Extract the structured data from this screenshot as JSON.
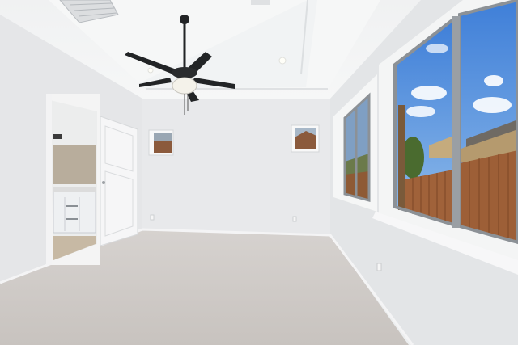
{
  "photo": {
    "subject": "empty-bedroom-interior",
    "colors": {
      "ceiling": "#f2f3f4",
      "tray_ceiling": "#f7f8f8",
      "wall_left": "#e7e8ea",
      "wall_back": "#e9eaec",
      "wall_right": "#e4e6e8",
      "carpet": "#cfcbc7",
      "trim": "#f5f5f6",
      "fan": "#222426",
      "sky": "#4f8fde",
      "fence": "#a0623a",
      "window_frame": "#8c9196"
    },
    "objects": [
      "ceiling-fan",
      "recessed-light",
      "hvac-vent",
      "open-door",
      "bathroom-vanity",
      "small-window",
      "large-window",
      "wood-fence",
      "neighbor-house",
      "tree",
      "electrical-outlet"
    ]
  }
}
